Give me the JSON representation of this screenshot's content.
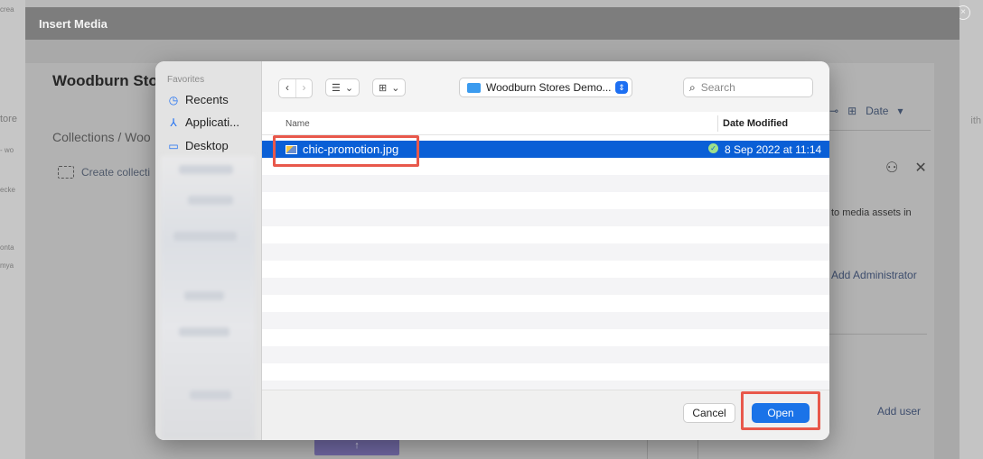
{
  "background": {
    "left_fragments": [
      "crea",
      "tore",
      "- wo",
      "ecke",
      "onta",
      "mya"
    ],
    "right_fragment": "ith",
    "close_glyph": "×"
  },
  "modal": {
    "title": "Insert Media",
    "store_title": "Woodburn Sto",
    "breadcrumb": "Collections / Woo",
    "create_collection": "Create collecti",
    "right_panel": {
      "sort_label": "Date",
      "description": "to media assets in",
      "add_administrator": "Add Administrator",
      "add_user": "Add user"
    }
  },
  "dialog": {
    "sidebar": {
      "section": "Favorites",
      "items": [
        {
          "label": "Recents",
          "icon": "clock-icon"
        },
        {
          "label": "Applicati...",
          "icon": "applications-icon"
        },
        {
          "label": "Desktop",
          "icon": "desktop-icon"
        }
      ]
    },
    "toolbar": {
      "location": "Woodburn Stores Demo...",
      "search_placeholder": "Search"
    },
    "columns": {
      "name": "Name",
      "date_modified": "Date Modified"
    },
    "files": [
      {
        "name": "chic-promotion.jpg",
        "date": "8 Sep 2022 at 11:14",
        "selected": true
      }
    ],
    "buttons": {
      "cancel": "Cancel",
      "open": "Open"
    }
  },
  "colors": {
    "selection": "#0a5fd6",
    "primary_button": "#1a73e8",
    "annotation": "#e8584b"
  }
}
